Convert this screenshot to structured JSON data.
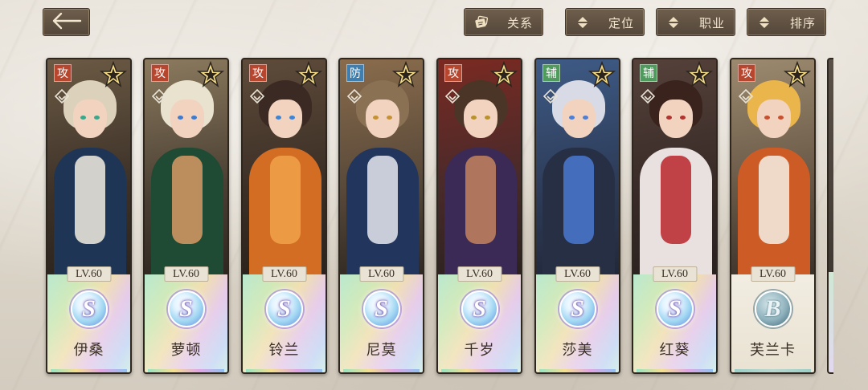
{
  "header": {
    "back_icon": "left-arrow-icon",
    "filters": [
      {
        "id": "relation",
        "label": "关系",
        "icon": "relation-icon"
      },
      {
        "id": "position",
        "label": "定位",
        "icon": "sort-updown-icon"
      },
      {
        "id": "class",
        "label": "职业",
        "icon": "sort-updown-icon"
      },
      {
        "id": "sort",
        "label": "排序",
        "icon": "sort-updown-icon"
      }
    ]
  },
  "characters": [
    {
      "name": "伊桑",
      "role": "攻",
      "level": "LV.60",
      "rank": "S",
      "role_color": "#b7462f",
      "hair": "#dcd2bb",
      "eye": "#39a88a",
      "outfit": "#1e3556",
      "accent": "#f2ece0"
    },
    {
      "name": "萝顿",
      "role": "攻",
      "level": "LV.60",
      "rank": "S",
      "role_color": "#b7462f",
      "hair": "#e8e2cf",
      "eye": "#3c7bd0",
      "outfit": "#1f4a33",
      "accent": "#d89a66"
    },
    {
      "name": "铃兰",
      "role": "攻",
      "level": "LV.60",
      "rank": "S",
      "role_color": "#b7462f",
      "hair": "#3b2a23",
      "eye": "#3b84d6",
      "outfit": "#d36d24",
      "accent": "#f0a34a"
    },
    {
      "name": "尼莫",
      "role": "防",
      "level": "LV.60",
      "rank": "S",
      "role_color": "#3e7fb0",
      "hair": "#8a7154",
      "eye": "#c49232",
      "outfit": "#22355d",
      "accent": "#e6e6ee"
    },
    {
      "name": "千岁",
      "role": "攻",
      "level": "LV.60",
      "rank": "S",
      "role_color": "#b7462f",
      "hair": "#4a3526",
      "eye": "#b8922c",
      "outfit": "#3a2a55",
      "accent": "#c4835f"
    },
    {
      "name": "莎美",
      "role": "辅",
      "level": "LV.60",
      "rank": "S",
      "role_color": "#4f9b5d",
      "hair": "#d8dbe6",
      "eye": "#4c7fd6",
      "outfit": "#262f44",
      "accent": "#4a78d0"
    },
    {
      "name": "红葵",
      "role": "辅",
      "level": "LV.60",
      "rank": "S",
      "role_color": "#4f9b5d",
      "hair": "#3b231d",
      "eye": "#b0332d",
      "outfit": "#e9e1e0",
      "accent": "#b8252a"
    },
    {
      "name": "芙兰卡",
      "role": "攻",
      "level": "LV.60",
      "rank": "B",
      "role_color": "#b7462f",
      "hair": "#eab64c",
      "eye": "#c8502e",
      "outfit": "#cd5b26",
      "accent": "#f5f0e6"
    }
  ]
}
